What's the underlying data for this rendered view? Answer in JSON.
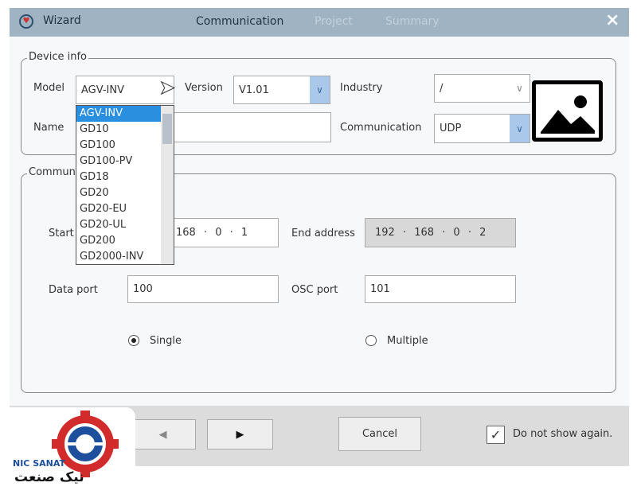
{
  "titlebar": {
    "title": "Wizard",
    "steps": [
      {
        "label": "Communication",
        "active": true
      },
      {
        "label": "Project",
        "active": false
      },
      {
        "label": "Summary",
        "active": false
      }
    ],
    "close": "×"
  },
  "device_info": {
    "legend": "Device info",
    "model_label": "Model",
    "model_value": "AGV-INV",
    "version_label": "Version",
    "version_value": "V1.01",
    "industry_label": "Industry",
    "industry_value": "/",
    "name_label": "Name",
    "name_value": "",
    "communication_label": "Communication",
    "communication_value": "UDP",
    "image_icon": "image-placeholder-icon"
  },
  "model_dropdown": {
    "options": [
      "AGV-INV",
      "GD10",
      "GD100",
      "GD100-PV",
      "GD18",
      "GD20",
      "GD20-EU",
      "GD20-UL",
      "GD200",
      "GD2000-INV"
    ],
    "selected": "AGV-INV"
  },
  "communication": {
    "legend": "Communication",
    "start_label": "Start address",
    "start_value": "192 · 168 · 0 · 1",
    "start_visible": "168 · 0 · 1",
    "end_label": "End address",
    "end_value": "192 · 168 · 0 · 2",
    "data_port_label": "Data port",
    "data_port_value": "100",
    "osc_port_label": "OSC port",
    "osc_port_value": "101",
    "single_label": "Single",
    "multiple_label": "Multiple",
    "mode": "Single"
  },
  "footer": {
    "back": "◀",
    "forward": "▶",
    "cancel": "Cancel",
    "do_not_show": "Do not show again.",
    "do_not_show_checked": true
  },
  "logo": {
    "text_en": "NIC SANAT",
    "text_fa": "نیک صنعت"
  },
  "colors": {
    "titlebar": "#9fb3c3",
    "selection": "#2b8fe0",
    "combo_arrow": "#a9c8ea",
    "logo_red": "#d22b2b",
    "logo_blue": "#1d4f9c"
  }
}
